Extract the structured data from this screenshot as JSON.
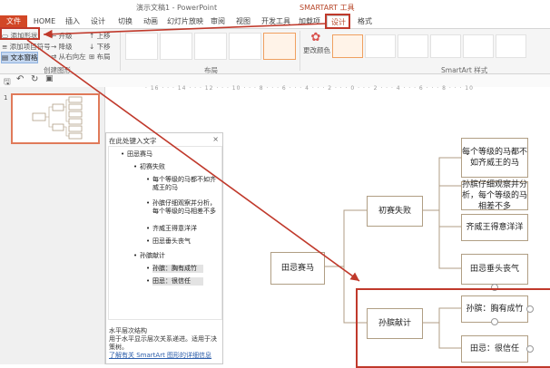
{
  "window": {
    "title": "演示文稿1 - PowerPoint",
    "context_tab_group": "SMARTART 工具"
  },
  "tabs": [
    "文件",
    "HOME",
    "插入",
    "设计",
    "切换",
    "动画",
    "幻灯片放映",
    "审阅",
    "视图",
    "开发工具",
    "加载项",
    "设计",
    "格式"
  ],
  "ribbon": {
    "create_graphic": {
      "add_shape": "添加形状",
      "add_bullet": "添加项目符号",
      "text_pane": "文本窗格",
      "promote": "升级",
      "demote": "降级",
      "move_up": "上移",
      "move_down": "下移",
      "right_to_left": "从右向左",
      "layout": "布局",
      "group_label": "创建图形"
    },
    "layouts_label": "布局",
    "change_colors": "更改颜色",
    "styles_label": "SmartArt 样式"
  },
  "text_pane": {
    "title": "在此处键入文字",
    "close": "×",
    "items": [
      {
        "level": 1,
        "text": "田忌赛马"
      },
      {
        "level": 2,
        "text": "初赛失败"
      },
      {
        "level": 3,
        "text": "每个等级的马都不如齐威王的马"
      },
      {
        "level": 3,
        "text": "孙膑仔细观察并分析，每个等级的马相差不多"
      },
      {
        "level": 3,
        "text": "齐威王得意洋洋"
      },
      {
        "level": 3,
        "text": "田忌垂头丧气"
      },
      {
        "level": 2,
        "text": "孙膑献计"
      },
      {
        "level": 3,
        "text": "孙膑：胸有成竹"
      },
      {
        "level": 3,
        "text": "田忌：很信任"
      }
    ],
    "footer_title": "水平层次结构",
    "footer_desc": "用于水平显示层次关系递进。适用于决策树。",
    "footer_link": "了解有关 SmartArt 图形的详细信息"
  },
  "diagram": {
    "root": "田忌赛马",
    "branch1": "初赛失败",
    "branch2": "孙膑献计",
    "leaf1": "每个等级的马都不如齐威王的马",
    "leaf2": "孙膑仔细观察并分析，每个等级的马相差不多",
    "leaf3": "齐威王得意洋洋",
    "leaf4": "田忌垂头丧气",
    "leaf5": "孙膑：胸有成竹",
    "leaf6": "田忌：很信任"
  },
  "slide_panel": {
    "slide_number": "1"
  },
  "colors": {
    "file_tab": "#d24726",
    "accent": "#b7472a",
    "annotation": "#c0392b",
    "node_border": "#b09e84"
  }
}
